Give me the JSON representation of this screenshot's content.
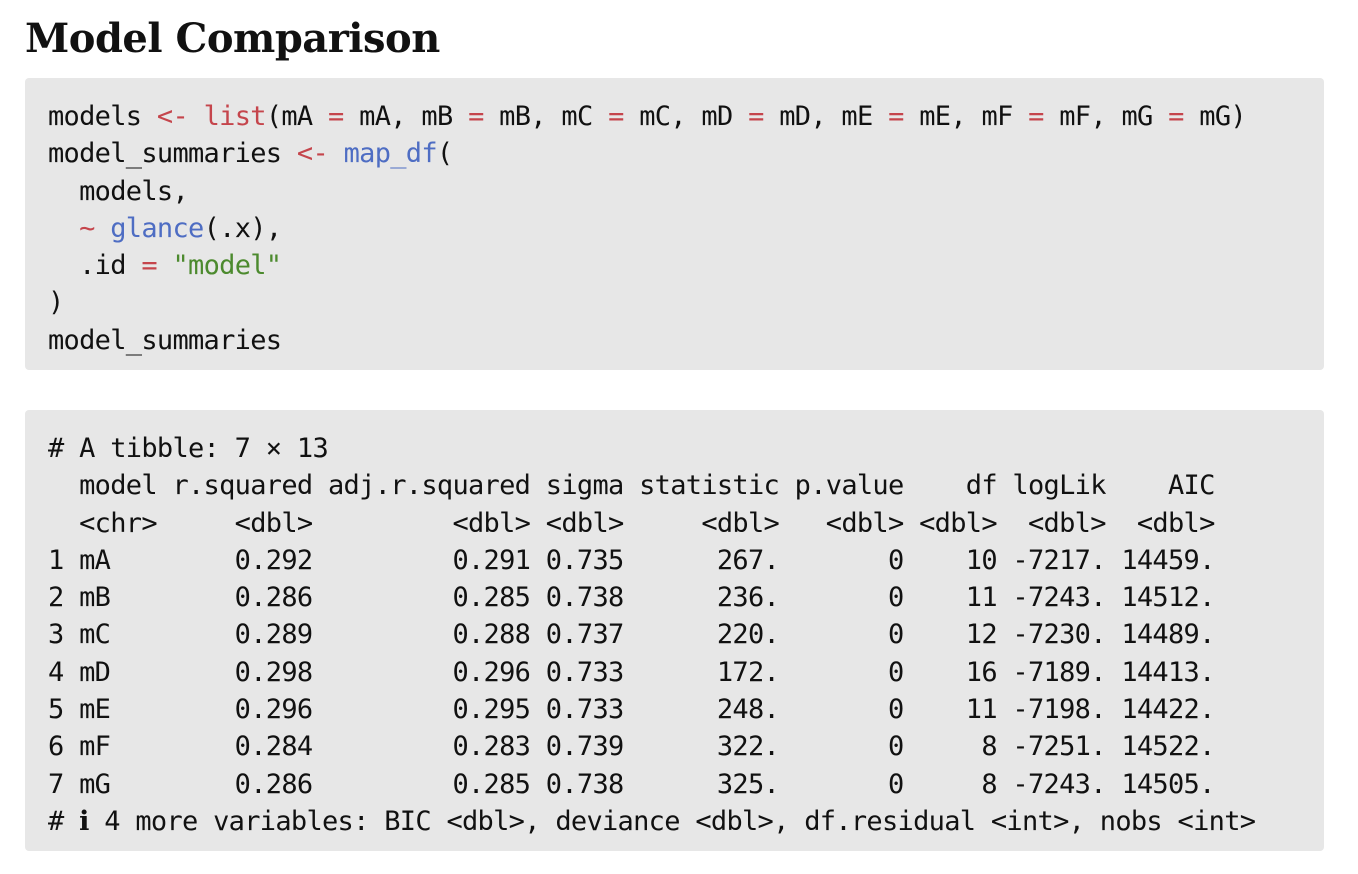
{
  "title": "Model Comparison",
  "code": {
    "lines": [
      [
        {
          "t": "plain",
          "v": "models "
        },
        {
          "t": "op",
          "v": "<-"
        },
        {
          "t": "plain",
          "v": " "
        },
        {
          "t": "op",
          "v": "list"
        },
        {
          "t": "plain",
          "v": "(mA "
        },
        {
          "t": "op",
          "v": "="
        },
        {
          "t": "plain",
          "v": " mA, mB "
        },
        {
          "t": "op",
          "v": "="
        },
        {
          "t": "plain",
          "v": " mB, mC "
        },
        {
          "t": "op",
          "v": "="
        },
        {
          "t": "plain",
          "v": " mC, mD "
        },
        {
          "t": "op",
          "v": "="
        },
        {
          "t": "plain",
          "v": " mD, mE "
        },
        {
          "t": "op",
          "v": "="
        },
        {
          "t": "plain",
          "v": " mE, mF "
        },
        {
          "t": "op",
          "v": "="
        },
        {
          "t": "plain",
          "v": " mF, mG "
        },
        {
          "t": "op",
          "v": "="
        },
        {
          "t": "plain",
          "v": " mG)"
        }
      ],
      [
        {
          "t": "plain",
          "v": "model_summaries "
        },
        {
          "t": "op",
          "v": "<-"
        },
        {
          "t": "plain",
          "v": " "
        },
        {
          "t": "fn",
          "v": "map_df"
        },
        {
          "t": "plain",
          "v": "("
        }
      ],
      [
        {
          "t": "plain",
          "v": "  models,"
        }
      ],
      [
        {
          "t": "plain",
          "v": "  "
        },
        {
          "t": "op",
          "v": "~"
        },
        {
          "t": "plain",
          "v": " "
        },
        {
          "t": "fn",
          "v": "glance"
        },
        {
          "t": "plain",
          "v": "(.x),"
        }
      ],
      [
        {
          "t": "plain",
          "v": "  .id "
        },
        {
          "t": "op",
          "v": "="
        },
        {
          "t": "plain",
          "v": " "
        },
        {
          "t": "str",
          "v": "\"model\""
        }
      ],
      [
        {
          "t": "plain",
          "v": ")"
        }
      ],
      [
        {
          "t": "plain",
          "v": "model_summaries"
        }
      ]
    ]
  },
  "output": {
    "lines": [
      "# A tibble: 7 × 13",
      "  model r.squared adj.r.squared sigma statistic p.value    df logLik    AIC",
      "  <chr>     <dbl>         <dbl> <dbl>     <dbl>   <dbl> <dbl>  <dbl>  <dbl>",
      "1 mA        0.292         0.291 0.735      267.       0    10 -7217. 14459.",
      "2 mB        0.286         0.285 0.738      236.       0    11 -7243. 14512.",
      "3 mC        0.289         0.288 0.737      220.       0    12 -7230. 14489.",
      "4 mD        0.298         0.296 0.733      172.       0    16 -7189. 14413.",
      "5 mE        0.296         0.295 0.733      248.       0    11 -7198. 14422.",
      "6 mF        0.284         0.283 0.739      322.       0     8 -7251. 14522.",
      "7 mG        0.286         0.285 0.738      325.       0     8 -7243. 14505.",
      "# ℹ 4 more variables: BIC <dbl>, deviance <dbl>, df.residual <int>, nobs <int>"
    ]
  },
  "colors": {
    "block_background": "#e7e7e7",
    "operator": "#c5454c",
    "function": "#4e6dc3",
    "string": "#4c8a2e"
  }
}
